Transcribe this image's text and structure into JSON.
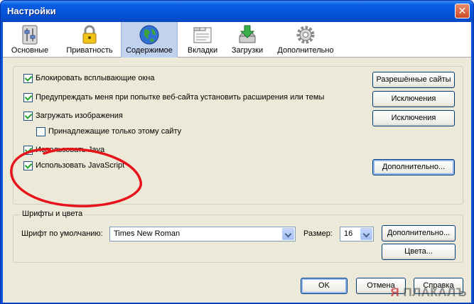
{
  "window": {
    "title": "Настройки",
    "close_glyph": "✕"
  },
  "toolbar": {
    "tabs": [
      {
        "label": "Основные",
        "icon": "sliders-icon"
      },
      {
        "label": "Приватность",
        "icon": "lock-icon"
      },
      {
        "label": "Содержимое",
        "icon": "globe-icon",
        "active": true
      },
      {
        "label": "Вкладки",
        "icon": "tabs-window-icon"
      },
      {
        "label": "Загрузки",
        "icon": "download-icon"
      },
      {
        "label": "Дополнительно",
        "icon": "gear-icon"
      }
    ]
  },
  "content": {
    "options": [
      {
        "label": "Блокировать всплывающие окна",
        "checked": true
      },
      {
        "label": "Предупреждать меня при попытке веб-сайта установить расширения или темы",
        "checked": true
      },
      {
        "label": "Загружать изображения",
        "checked": true
      },
      {
        "label": "Принадлежащие только этому сайту",
        "checked": false
      },
      {
        "label": "Использовать Java",
        "checked": true
      },
      {
        "label": "Использовать JavaScript",
        "checked": true
      }
    ],
    "buttons": {
      "allowed_sites": "Разрешённые сайты",
      "exceptions_1": "Исключения",
      "exceptions_2": "Исключения",
      "advanced_js": "Дополнительно..."
    }
  },
  "fonts": {
    "group_title": "Шрифты и цвета",
    "default_font_label": "Шрифт по умолчанию:",
    "default_font_value": "Times New Roman",
    "size_label": "Размер:",
    "size_value": "16",
    "advanced_button": "Дополнительно...",
    "colors_button": "Цвета..."
  },
  "footer": {
    "ok": "OK",
    "cancel": "Отмена",
    "help": "Справка"
  },
  "watermark": {
    "text_a": "Я",
    "text_b": "ПЛАКАЛЪ"
  },
  "colors": {
    "titlebar": "#0453d8",
    "annotation": "#e8121a",
    "dialog_bg": "#ece9d8"
  }
}
